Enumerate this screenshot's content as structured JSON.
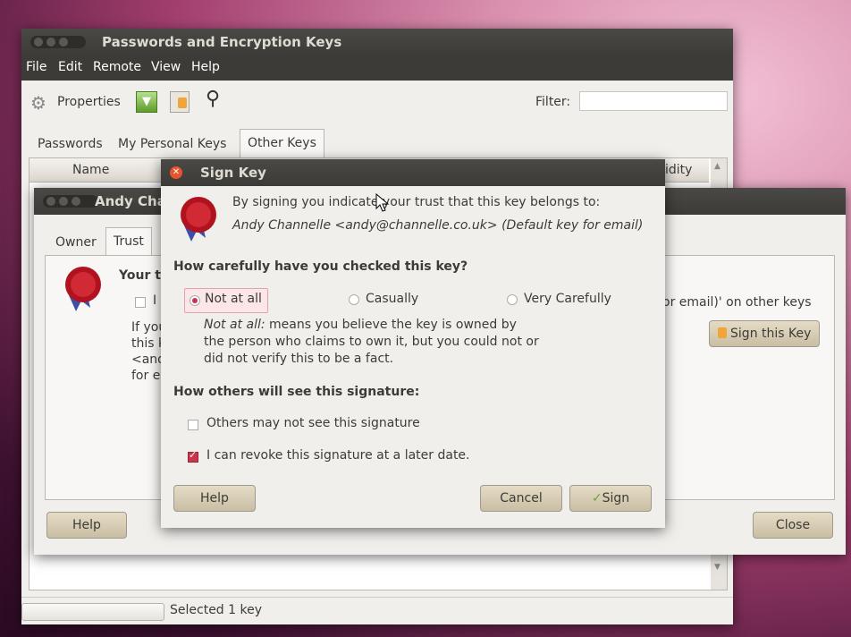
{
  "main_window": {
    "title": "Passwords and Encryption Keys",
    "menu": [
      "File",
      "Edit",
      "Remote",
      "View",
      "Help"
    ],
    "toolbar": {
      "properties_label": "Properties",
      "filter_label": "Filter:",
      "filter_value": ""
    },
    "tabs": [
      "Passwords",
      "My Personal Keys",
      "Other Keys"
    ],
    "active_tab": "Other Keys",
    "columns": {
      "name": "Name",
      "validity": "Validity"
    },
    "status": "Selected 1 key"
  },
  "key_window": {
    "title": "Andy Channelle",
    "tabs": [
      "Owner",
      "Trust"
    ],
    "active_tab": "Trust",
    "your_trust_heading": "Your trust",
    "check_label": "I",
    "desc_lines": [
      "If you",
      "this k",
      "<and",
      "for e"
    ],
    "right_text": "or email)' on other keys",
    "sign_button": "Sign this Key",
    "help_button": "Help",
    "close_button": "Close"
  },
  "sign_dialog": {
    "title": "Sign Key",
    "intro": "By signing you indicate your trust that this key belongs to:",
    "key_owner": "Andy Channelle <andy@channelle.co.uk> (Default key for email)",
    "checked_heading": "How carefully have you checked this key?",
    "options": [
      "Not at all",
      "Casually",
      "Very Carefully"
    ],
    "selected_option": "Not at all",
    "explain_emph": "Not at all:",
    "explain_lines": [
      " means you believe the key is owned by",
      "the person who claims to own it, but you could not or",
      "did not verify this to be a fact."
    ],
    "others_heading": "How others will see this signature:",
    "others_check": "Others may not see this signature",
    "others_checked": false,
    "revoke_check": "I can revoke this signature at a later date.",
    "revoke_checked": true,
    "help_button": "Help",
    "cancel_button": "Cancel",
    "sign_button": "Sign"
  },
  "colors": {
    "titlebar": "#3c3b37",
    "accent_red": "#c7364a",
    "button": "#d8cdb4",
    "window_bg": "#f1efec"
  }
}
